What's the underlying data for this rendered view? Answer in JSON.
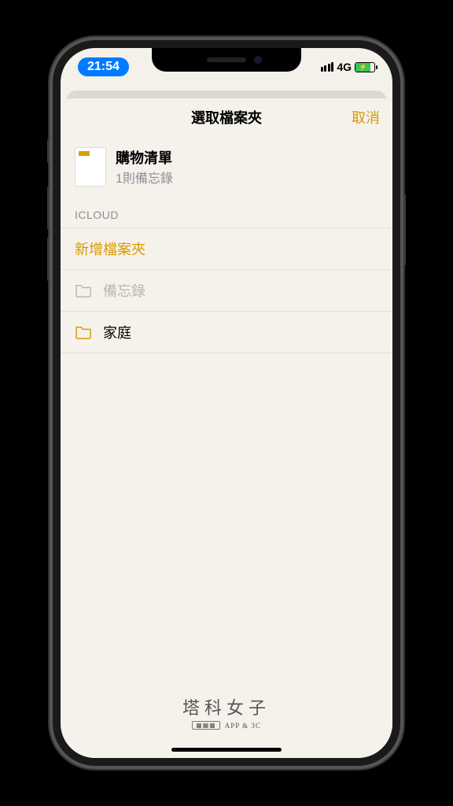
{
  "status": {
    "time": "21:54",
    "network": "4G"
  },
  "nav": {
    "title": "選取檔案夾",
    "cancel": "取消"
  },
  "note": {
    "title": "購物清單",
    "subtitle": "1則備忘錄"
  },
  "section_header": "ICLOUD",
  "rows": {
    "new_folder": "新增檔案夾",
    "notes_folder": "備忘錄",
    "family_folder": "家庭"
  },
  "watermark": {
    "main": "塔科女子",
    "sub": "APP & 3C"
  },
  "colors": {
    "accent": "#d99a00"
  }
}
